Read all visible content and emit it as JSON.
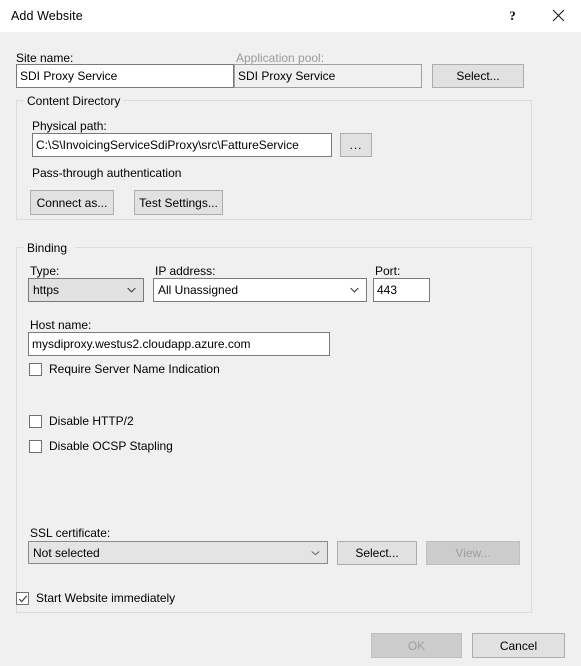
{
  "window": {
    "title": "Add Website",
    "help_icon": "?",
    "close_icon": "close-icon"
  },
  "site": {
    "name_label": "Site name:",
    "name_value": "SDI Proxy Service",
    "app_pool_label": "Application pool:",
    "app_pool_value": "SDI Proxy Service",
    "app_pool_select_label": "Select..."
  },
  "content_directory": {
    "legend": "Content Directory",
    "physical_path_label": "Physical path:",
    "physical_path_value": "C:\\S\\InvoicingServiceSdiProxy\\src\\FattureService",
    "browse_label": "...",
    "pass_through_label": "Pass-through authentication",
    "connect_as_label": "Connect as...",
    "test_settings_label": "Test Settings..."
  },
  "binding": {
    "legend": "Binding",
    "type_label": "Type:",
    "type_value": "https",
    "ip_label": "IP address:",
    "ip_value": "All Unassigned",
    "port_label": "Port:",
    "port_value": "443",
    "host_label": "Host name:",
    "host_value": "mysdiproxy.westus2.cloudapp.azure.com",
    "require_sni_label": "Require Server Name Indication",
    "require_sni_checked": false,
    "disable_http2_label": "Disable HTTP/2",
    "disable_http2_checked": false,
    "disable_ocsp_label": "Disable OCSP Stapling",
    "disable_ocsp_checked": false,
    "ssl_cert_label": "SSL certificate:",
    "ssl_cert_value": "Not selected",
    "ssl_select_label": "Select...",
    "ssl_view_label": "View..."
  },
  "footer": {
    "start_website_label": "Start Website immediately",
    "start_website_checked": true,
    "ok_label": "OK",
    "cancel_label": "Cancel"
  },
  "colors": {
    "window_bg": "#f0f0f0",
    "titlebar_bg": "#ffffff",
    "field_border": "#7a7a7a",
    "button_face": "#e1e1e1",
    "button_border": "#adadad",
    "group_border": "#dcdcdc",
    "disabled_text": "#a0a0a0"
  }
}
